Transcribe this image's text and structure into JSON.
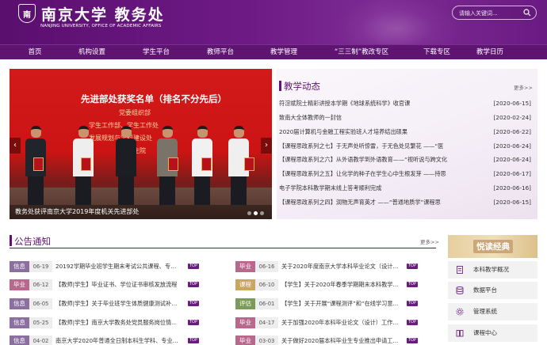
{
  "header": {
    "emblem_text": "南",
    "title_cn": "南京大学 教务处",
    "title_en": "NANJING UNIVERSITY, OFFICE OF ACADEMIC AFFAIRS",
    "search_placeholder": "请输入关键词..."
  },
  "nav": [
    "首页",
    "机构设置",
    "学生平台",
    "教师平台",
    "教学管理",
    "“三三制”教改专区",
    "下载专区",
    "教学日历"
  ],
  "carousel": {
    "banner_title": "先进部处获奖名单（排名不分先后）",
    "banner_lines": [
      "党委组织部",
      "学生工作部、学生工作处",
      "发展规划与学科建设处",
      "研究生院"
    ],
    "caption": "教务处获评南京大学2019年度机关先进部处",
    "prev": "‹",
    "next": "›"
  },
  "news": {
    "title": "教学动态",
    "more": "更多>>",
    "items": [
      {
        "title": "符淙斌院士精彩讲授本学期《地球系统科学》收官课",
        "date": "[2020-06-15]"
      },
      {
        "title": "致南大全体教师的一封信",
        "date": "[2020-02-24]"
      },
      {
        "title": "2020届计算机与金融工程实验班人才培养结出硕果",
        "date": "[2020-06-22]"
      },
      {
        "title": "【课程思政系列之七】于无声处听惊雷，于无色处见繁花 ——“医",
        "date": "[2020-06-24]"
      },
      {
        "title": "【课程思政系列之六】从外语教学到外语教育——“视听说与跨文化",
        "date": "[2020-06-24]"
      },
      {
        "title": "【课程思政系列之五】让化学的种子在学生心中生根发芽 ——持思",
        "date": "[2020-06-17]"
      },
      {
        "title": "电子学院本科教学期末线上答考顺利完成",
        "date": "[2020-06-16]"
      },
      {
        "title": "【课程思政系列之四】润物无声育英才 ——“普通地质学”课程思",
        "date": "[2020-06-15]"
      }
    ]
  },
  "announcements": {
    "title": "公告通知",
    "more": "更多>>",
    "top_label": "TOP",
    "left": [
      {
        "tag": "信息",
        "date": "06-19",
        "title": "20192学期毕业班学生期末考试公共课程、专业..."
      },
      {
        "tag": "毕业",
        "date": "06-12",
        "title": "【教师|学生】毕业证书、学位证书审核发放流程"
      },
      {
        "tag": "信息",
        "date": "06-05",
        "title": "【教师|学生】关于毕业班学生体质健康测试补测的..."
      },
      {
        "tag": "信息",
        "date": "05-25",
        "title": "【教师|学生】南京大学教务处党员服务岗位情..."
      },
      {
        "tag": "信息",
        "date": "04-02",
        "title": "南京大学2020年普通全日制本科生学科、专业..."
      }
    ],
    "right": [
      {
        "tag": "毕业",
        "date": "06-16",
        "title": "关于2020年度南京大学本科毕业论文（设计..."
      },
      {
        "tag": "课程",
        "date": "06-10",
        "title": "【学生】关于2020年春季学期期末本科教学..."
      },
      {
        "tag": "评估",
        "date": "06-01",
        "title": "【学生】关于开展“课程测评”和“在线学习意..."
      },
      {
        "tag": "毕业",
        "date": "04-17",
        "title": "关于加强2020年本科毕业论文（设计）工作..."
      },
      {
        "tag": "毕业",
        "date": "03-03",
        "title": "关于做好2020届本科毕业生专业推出申请工..."
      }
    ]
  },
  "sidebar": {
    "header": "悦读经典",
    "items": [
      {
        "label": "本科教学概况",
        "icon": "document-icon"
      },
      {
        "label": "数据平台",
        "icon": "database-icon"
      },
      {
        "label": "管理系统",
        "icon": "settings-icon"
      },
      {
        "label": "课程中心",
        "icon": "book-icon"
      }
    ]
  },
  "colors": {
    "primary_purple": "#5f1471",
    "tag_info": "#8a6fa0",
    "tag_grad": "#b7688c",
    "tag_course": "#c9a75f",
    "tag_eval": "#7c9a5a"
  }
}
